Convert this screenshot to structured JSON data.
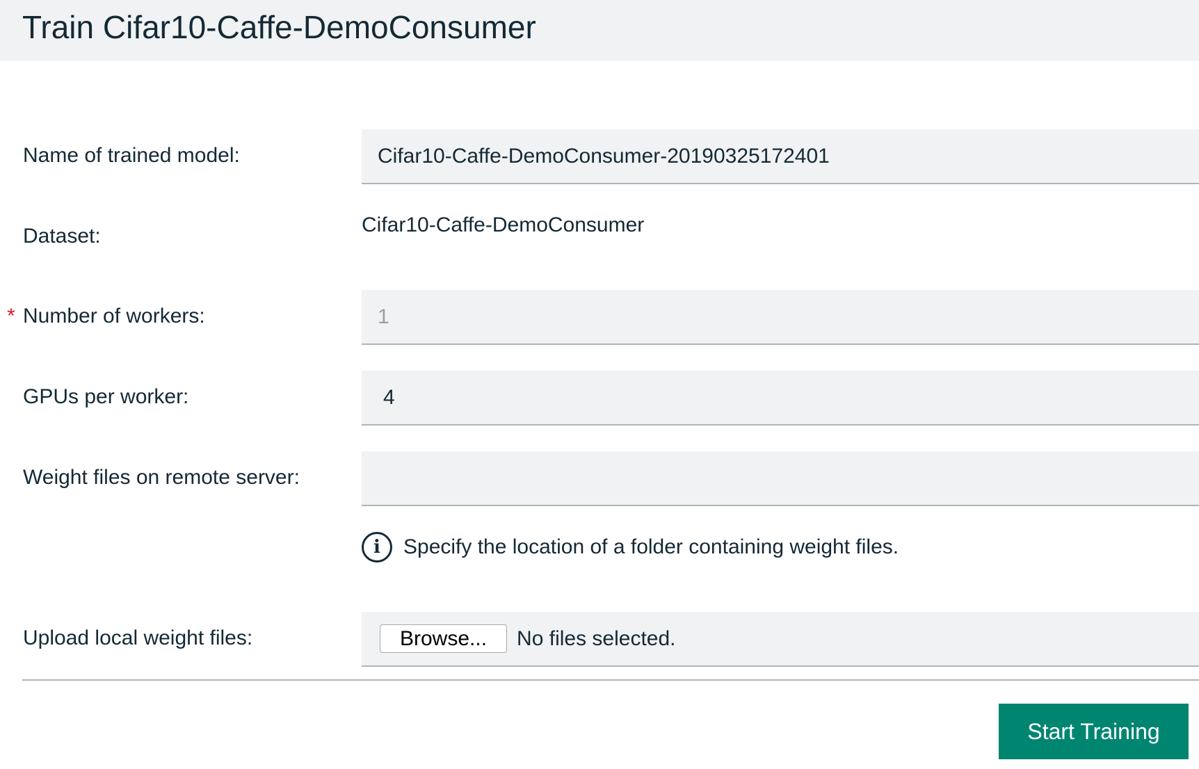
{
  "header": {
    "title": "Train Cifar10-Caffe-DemoConsumer"
  },
  "form": {
    "model_name": {
      "label": "Name of trained model:",
      "value": "Cifar10-Caffe-DemoConsumer-20190325172401"
    },
    "dataset": {
      "label": "Dataset:",
      "value": "Cifar10-Caffe-DemoConsumer"
    },
    "workers": {
      "required_marker": "*",
      "label": "Number of workers:",
      "value": "1"
    },
    "gpus": {
      "label": "GPUs per worker:",
      "value": "4"
    },
    "remote_weights": {
      "label": "Weight files on remote server:",
      "value": "",
      "helper_icon": "info-icon",
      "helper_icon_glyph": "i",
      "helper_text": "Specify the location of a folder containing weight files."
    },
    "local_weights": {
      "label": "Upload local weight files:",
      "browse_label": "Browse...",
      "status": "No files selected."
    }
  },
  "actions": {
    "start_label": "Start Training",
    "start_color": "#008571"
  },
  "colors": {
    "required": "#e0182d",
    "field_bg": "#f0f2f3",
    "text": "#152935"
  }
}
